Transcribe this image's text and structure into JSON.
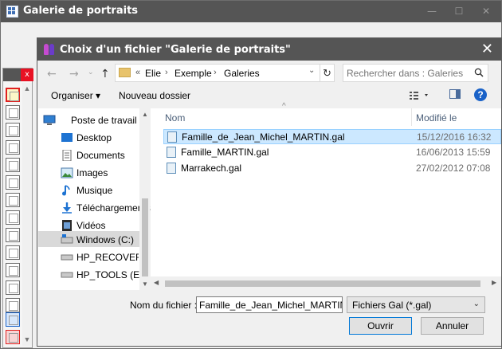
{
  "app": {
    "title": "Galerie de portraits"
  },
  "dialog": {
    "title": "Choix d'un fichier \"Galerie de portraits\"",
    "address": {
      "prefix": "«",
      "crumbs": [
        "Elie",
        "Exemple",
        "Galeries"
      ]
    },
    "search": {
      "placeholder": "Rechercher dans : Galeries"
    },
    "commands": {
      "organise": "Organiser ▾",
      "new_folder": "Nouveau dossier"
    },
    "nav": [
      {
        "label": "Poste de travail",
        "icon": "computer-icon"
      },
      {
        "label": "Desktop",
        "icon": "desktop-icon"
      },
      {
        "label": "Documents",
        "icon": "documents-icon"
      },
      {
        "label": "Images",
        "icon": "images-icon"
      },
      {
        "label": "Musique",
        "icon": "music-icon"
      },
      {
        "label": "Téléchargements",
        "icon": "downloads-icon"
      },
      {
        "label": "Vidéos",
        "icon": "videos-icon"
      },
      {
        "label": "Windows  (C:)",
        "icon": "drive-icon",
        "selected": true
      },
      {
        "label": "HP_RECOVERY (D:)",
        "icon": "drive-icon"
      },
      {
        "label": "HP_TOOLS (E:)",
        "icon": "drive-icon"
      }
    ],
    "columns": {
      "name": "Nom",
      "modified": "Modifié le"
    },
    "files": [
      {
        "name": "Famille_de_Jean_Michel_MARTIN.gal",
        "modified": "15/12/2016 16:32",
        "selected": true
      },
      {
        "name": "Famille_MARTIN.gal",
        "modified": "16/06/2013 15:59",
        "selected": false
      },
      {
        "name": "Marrakech.gal",
        "modified": "27/02/2012 07:08",
        "selected": false
      }
    ],
    "filename": {
      "label": "Nom du fichier :",
      "value": "Famille_de_Jean_Michel_MARTIN.gal"
    },
    "filetype": {
      "value": "Fichiers Gal (*.gal)"
    },
    "buttons": {
      "open": "Ouvrir",
      "cancel": "Annuler"
    }
  },
  "colors": {
    "titlebar": "#555555",
    "selection": "#cce8ff",
    "close": "#e81123",
    "accent": "#0078d7"
  }
}
